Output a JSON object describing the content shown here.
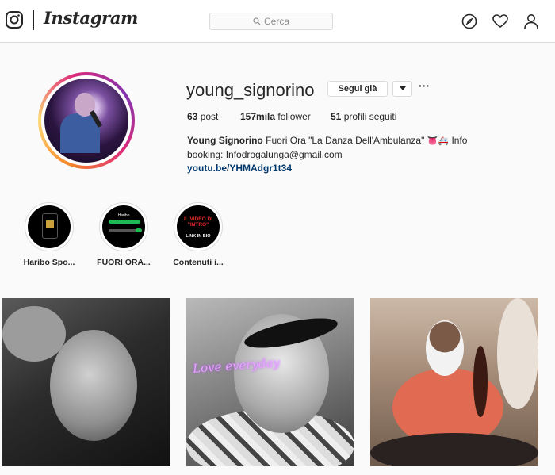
{
  "nav": {
    "brand": "Instagram",
    "search_placeholder": "Cerca",
    "icons": [
      "instagram-logo-icon",
      "compass-icon",
      "heart-icon",
      "user-icon"
    ]
  },
  "profile": {
    "username": "young_signorino",
    "follow_button": "Segui già",
    "more": "···",
    "stats": {
      "posts_count": "63",
      "posts_label": "post",
      "followers_count": "157mila",
      "followers_label": "follower",
      "following_count": "51",
      "following_label": "profili seguiti"
    },
    "bio": {
      "name": "Young Signorino",
      "text_1": "Fuori Ora \"La Danza Dell'Ambulanza\"",
      "emoji_1": "👅",
      "emoji_2": "🚑",
      "text_2": "Info booking:",
      "text_3": "Infodrogalunga@gmail.com",
      "link": "youtu.be/YHMAdgr1t34"
    }
  },
  "highlights": [
    {
      "label": "Haribo Spo..."
    },
    {
      "label": "FUORI ORA...",
      "inner_title": "Haribo"
    },
    {
      "label": "Contenuti i...",
      "inner_line_1": "IL VIDEO DI",
      "inner_line_2": "\"INTRO\"",
      "inner_line_3": "LINK IN BIO"
    }
  ],
  "posts": [
    {
      "alt": "post-1"
    },
    {
      "alt": "post-2",
      "overlay_text": "Love everyday"
    },
    {
      "alt": "post-3"
    }
  ],
  "colors": {
    "link": "#00376b",
    "border": "#dbdbdb",
    "background": "#fafafa",
    "text": "#262626",
    "muted": "#8e8e8e"
  }
}
